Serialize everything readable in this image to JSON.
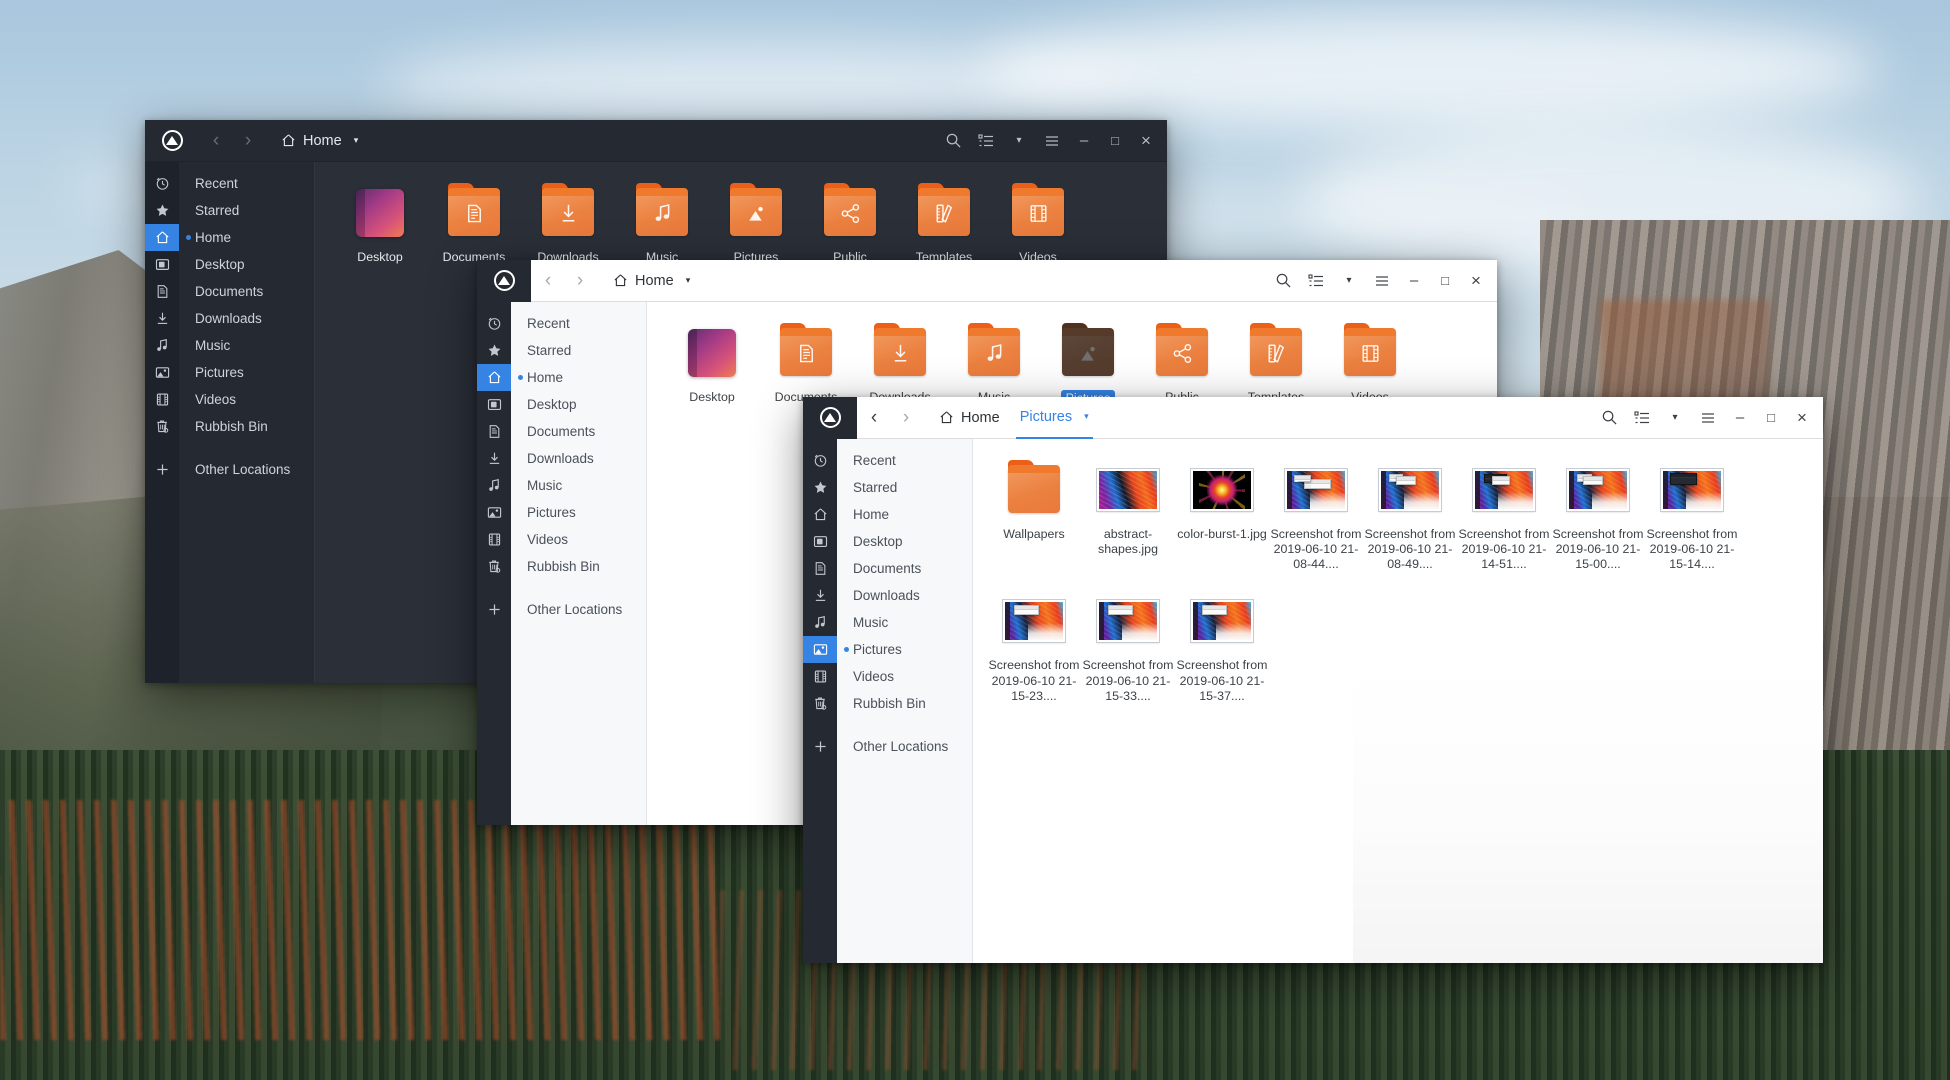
{
  "desktop": {
    "wallpaper_name": "yosemite-valley-wallpaper"
  },
  "icons": {
    "app": "files-app-icon",
    "back": "chevron-left-icon",
    "forward": "chevron-right-icon",
    "home": "home-icon",
    "caret": "chevron-down-icon",
    "search": "search-icon",
    "list_view": "list-view-icon",
    "view_dropdown": "chevron-down-icon",
    "menu": "hamburger-menu-icon",
    "minimize": "minimize-icon",
    "maximize": "maximize-icon",
    "close": "close-icon"
  },
  "glyphs": {
    "back": "‹",
    "forward": "›",
    "caret": "▾",
    "minimize": "–",
    "maximize": "□",
    "close": "×",
    "plus": "+"
  },
  "colors": {
    "accent": "#3584e4",
    "folder_orange": "#eb8140",
    "folder_tab": "#ec5f18",
    "titlebar_dark": "#252a32",
    "rail_dark": "#1e222a",
    "content_dark": "#2a2f38",
    "content_light": "#ffffff",
    "sidebar_light": "#f6f8fa"
  },
  "sidebar_items": [
    {
      "label": "Recent",
      "icon": "clock-icon"
    },
    {
      "label": "Starred",
      "icon": "star-icon"
    },
    {
      "label": "Home",
      "icon": "home-icon"
    },
    {
      "label": "Desktop",
      "icon": "desktop-icon"
    },
    {
      "label": "Documents",
      "icon": "document-icon"
    },
    {
      "label": "Downloads",
      "icon": "download-icon"
    },
    {
      "label": "Music",
      "icon": "music-note-icon"
    },
    {
      "label": "Pictures",
      "icon": "picture-icon"
    },
    {
      "label": "Videos",
      "icon": "film-icon"
    },
    {
      "label": "Rubbish Bin",
      "icon": "trash-icon"
    },
    {
      "label": "Other Locations",
      "icon": "plus-icon"
    }
  ],
  "home_folders": [
    {
      "label": "Desktop",
      "type": "gradient"
    },
    {
      "label": "Documents",
      "type": "folder",
      "glyph": "document-icon"
    },
    {
      "label": "Downloads",
      "type": "folder",
      "glyph": "download-icon"
    },
    {
      "label": "Music",
      "type": "folder",
      "glyph": "music-note-icon"
    },
    {
      "label": "Pictures",
      "type": "folder",
      "glyph": "picture-icon"
    },
    {
      "label": "Public",
      "type": "folder",
      "glyph": "share-icon"
    },
    {
      "label": "Templates",
      "type": "folder",
      "glyph": "ruler-pencil-icon"
    },
    {
      "label": "Videos",
      "type": "folder",
      "glyph": "film-icon"
    }
  ],
  "window1": {
    "theme": "dark",
    "title": "Home",
    "breadcrumbs": [
      {
        "label": "Home",
        "active": true,
        "home": true,
        "caret": true
      }
    ],
    "selected_sidebar": "Home",
    "selected_file": null
  },
  "window2": {
    "theme": "light",
    "title": "Home",
    "breadcrumbs": [
      {
        "label": "Home",
        "active": true,
        "home": true,
        "caret": true
      }
    ],
    "selected_sidebar": "Home",
    "selected_file": "Pictures"
  },
  "window3": {
    "theme": "light",
    "title": "Pictures",
    "breadcrumbs": [
      {
        "label": "Home",
        "active": false,
        "home": true,
        "caret": false
      },
      {
        "label": "Pictures",
        "active": true,
        "home": false,
        "caret": true
      }
    ],
    "selected_sidebar": "Pictures",
    "files": [
      {
        "label": "Wallpapers",
        "type": "folder"
      },
      {
        "label": "abstract-shapes.jpg",
        "type": "abstract"
      },
      {
        "label": "color-burst-1.jpg",
        "type": "burst"
      },
      {
        "label": "Screenshot from 2019-06-10 21-08-44....",
        "type": "shot",
        "variant": "a"
      },
      {
        "label": "Screenshot from 2019-06-10 21-08-49....",
        "type": "shot",
        "variant": "b"
      },
      {
        "label": "Screenshot from 2019-06-10 21-14-51....",
        "type": "shot",
        "variant": "c"
      },
      {
        "label": "Screenshot from 2019-06-10 21-15-00....",
        "type": "shot",
        "variant": "d"
      },
      {
        "label": "Screenshot from 2019-06-10 21-15-14....",
        "type": "shot",
        "variant": "e"
      },
      {
        "label": "Screenshot from 2019-06-10 21-15-23....",
        "type": "shot",
        "variant": "f"
      },
      {
        "label": "Screenshot from 2019-06-10 21-15-33....",
        "type": "shot",
        "variant": "g"
      },
      {
        "label": "Screenshot from 2019-06-10 21-15-37....",
        "type": "shot",
        "variant": "h"
      }
    ]
  }
}
